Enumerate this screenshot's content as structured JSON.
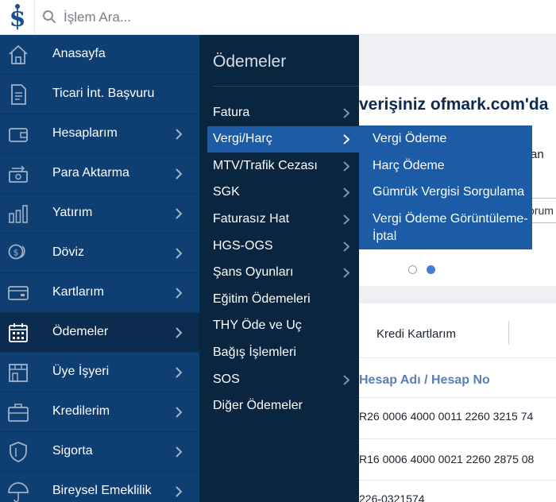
{
  "search": {
    "placeholder": "İşlem Ara..."
  },
  "sidebar": {
    "items": [
      {
        "label": "Anasayfa",
        "icon": "home-icon",
        "has_arrow": false
      },
      {
        "label": "Ticari İnt. Başvuru",
        "icon": "document-icon",
        "has_arrow": false
      },
      {
        "label": "Hesaplarım",
        "icon": "wallet-icon",
        "has_arrow": true
      },
      {
        "label": "Para Aktarma",
        "icon": "money-transfer-icon",
        "has_arrow": true
      },
      {
        "label": "Yatırım",
        "icon": "bar-chart-icon",
        "has_arrow": true
      },
      {
        "label": "Döviz",
        "icon": "coins-icon",
        "has_arrow": true
      },
      {
        "label": "Kartlarım",
        "icon": "credit-card-icon",
        "has_arrow": true
      },
      {
        "label": "Ödemeler",
        "icon": "calendar-icon",
        "has_arrow": true,
        "active": true
      },
      {
        "label": "Üye İşyeri",
        "icon": "storefront-icon",
        "has_arrow": true
      },
      {
        "label": "Kredilerim",
        "icon": "briefcase-icon",
        "has_arrow": true
      },
      {
        "label": "Sigorta",
        "icon": "shield-icon",
        "has_arrow": true
      },
      {
        "label": "Bireysel Emeklilik",
        "icon": "umbrella-icon",
        "has_arrow": true
      }
    ]
  },
  "submenu": {
    "title": "Ödemeler",
    "items": [
      {
        "label": "Fatura",
        "has_arrow": true
      },
      {
        "label": "Vergi/Harç",
        "has_arrow": true,
        "active": true
      },
      {
        "label": "MTV/Trafik Cezası",
        "has_arrow": true
      },
      {
        "label": "SGK",
        "has_arrow": true
      },
      {
        "label": "Faturasız Hat",
        "has_arrow": true
      },
      {
        "label": "HGS-OGS",
        "has_arrow": true
      },
      {
        "label": "Şans Oyunları",
        "has_arrow": true
      },
      {
        "label": "Eğitim Ödemeleri",
        "has_arrow": false
      },
      {
        "label": "THY Öde ve Uç",
        "has_arrow": false
      },
      {
        "label": "Bağış İşlemleri",
        "has_arrow": false
      },
      {
        "label": "SOS",
        "has_arrow": true
      },
      {
        "label": "Diğer Ödemeler",
        "has_arrow": false
      }
    ]
  },
  "flyout": {
    "items": [
      {
        "label": "Vergi Ödeme"
      },
      {
        "label": "Harç Ödeme"
      },
      {
        "label": "Gümrük Vergisi Sorgulama"
      },
      {
        "label": "Vergi Ödeme Görüntüleme-İptal"
      }
    ]
  },
  "background": {
    "banner_text": "verişiniz ofmark.com'da",
    "side_text": "an",
    "pill_text": "orum",
    "tab_label": "Kredi Kartlarım",
    "column_header": "Hesap Adı / Hesap No",
    "rows": [
      "R26 0006 4000 0011 2260 3215 74",
      "R16 0006 4000 0021 2260 2875 08",
      "226-0321574"
    ]
  },
  "colors": {
    "sidebar_bg": "#0f3e72",
    "submenu_bg": "#0a2540",
    "active_blue": "#1c5ba6",
    "logo_blue": "#1a4f8f"
  }
}
